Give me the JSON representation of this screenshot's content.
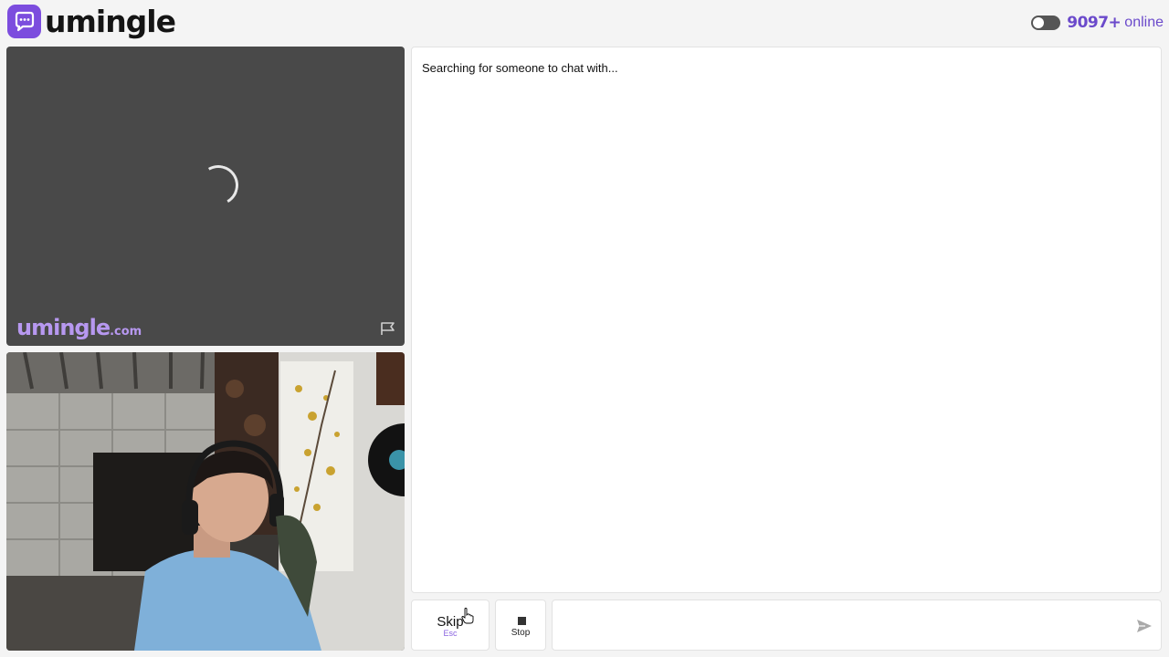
{
  "header": {
    "logo_text": "umingle",
    "logo_icon": "chat-bubble-icon",
    "online_count": "9097+",
    "online_label": "online",
    "toggle_state": "off"
  },
  "remote_video": {
    "watermark_main": "umingle",
    "watermark_suffix": ".com",
    "loading_icon": "spinner-icon",
    "report_icon": "flag-icon"
  },
  "local_video": {
    "description_icon": "webcam-feed"
  },
  "chat": {
    "status_text": "Searching for someone to chat with...",
    "message_placeholder": "",
    "send_icon": "send-icon"
  },
  "controls": {
    "skip_label": "Skip",
    "skip_shortcut": "Esc",
    "stop_label": "Stop"
  },
  "colors": {
    "brand": "#7c4dde",
    "accent_text": "#6b4acb",
    "watermark": "#b798f0"
  }
}
